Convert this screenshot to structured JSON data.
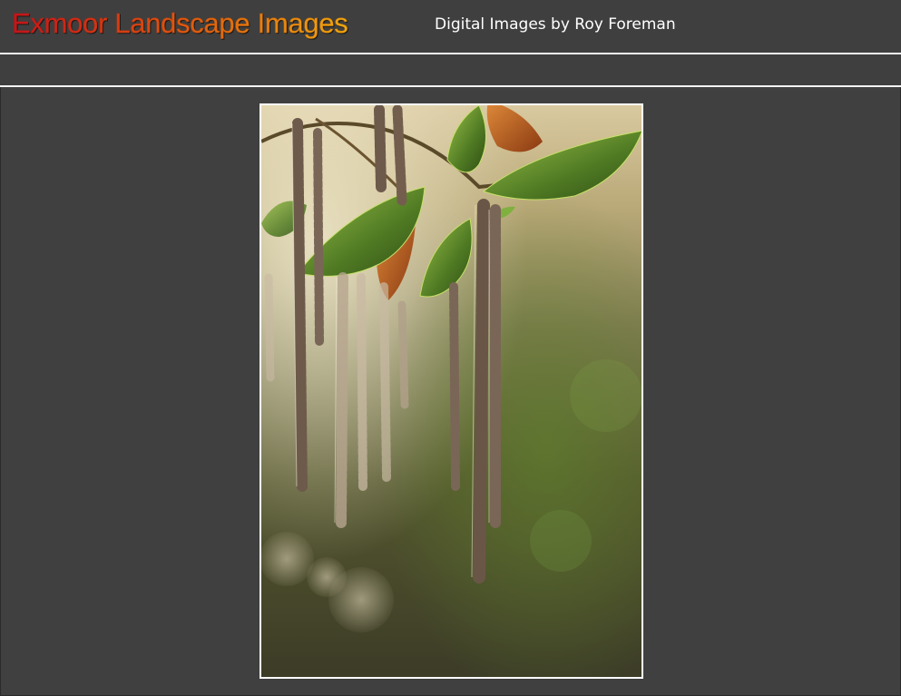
{
  "header": {
    "title": "Exmoor Landscape Images",
    "subtitle": "Digital Images by Roy Foreman"
  },
  "photo": {
    "subject": "catkins-photo"
  },
  "colors": {
    "background": "#404040",
    "rule": "#f4f4f4",
    "title_gradient_start": "#c8121b",
    "title_gradient_end": "#f0a90f",
    "subtitle": "#ffffff"
  }
}
